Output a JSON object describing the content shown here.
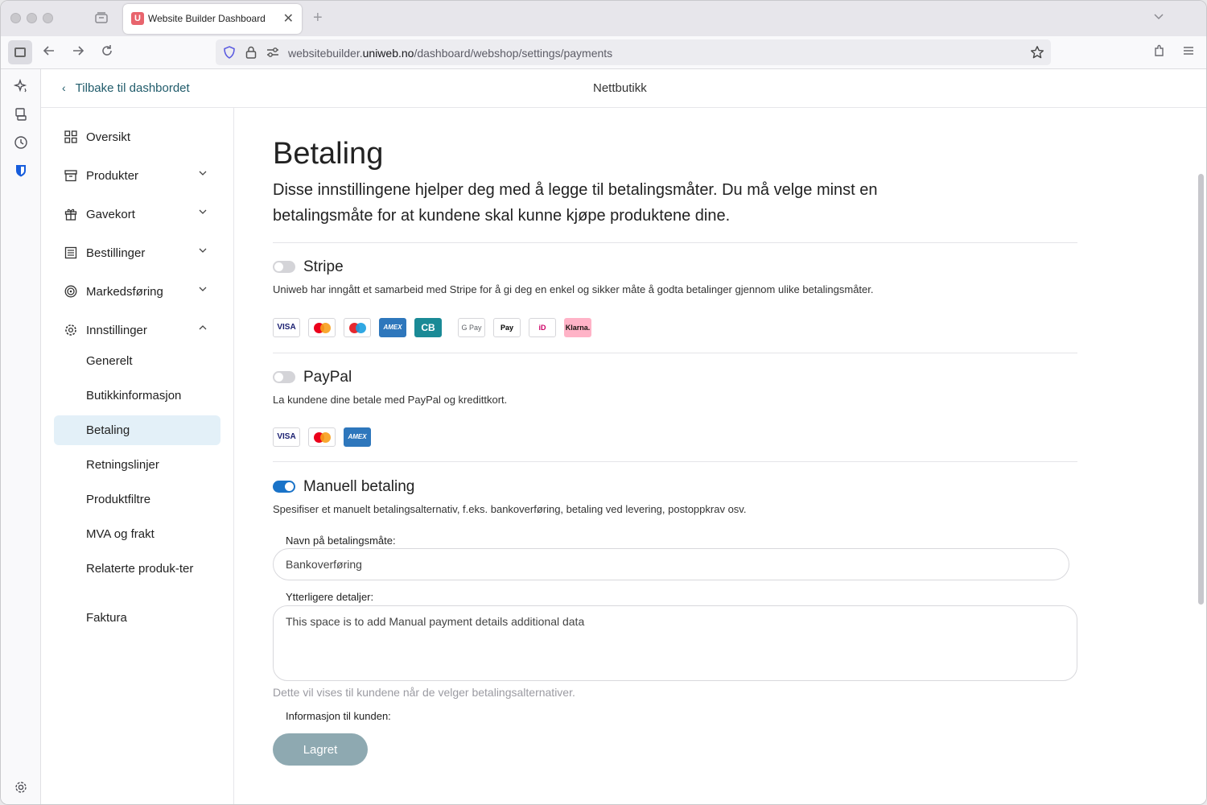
{
  "browser": {
    "tab_title": "Website Builder Dashboard",
    "tab_favicon": "U",
    "url_prefix": "websitebuilder.",
    "url_domain": "uniweb.no",
    "url_path": "/dashboard/webshop/settings/payments"
  },
  "header": {
    "back_label": "Tilbake til dashbordet",
    "title": "Nettbutikk"
  },
  "sidebar": {
    "items": [
      {
        "label": "Oversikt",
        "icon": "grid-icon"
      },
      {
        "label": "Produkter",
        "icon": "archive-icon"
      },
      {
        "label": "Gavekort",
        "icon": "gift-icon"
      },
      {
        "label": "Bestillinger",
        "icon": "list-icon"
      },
      {
        "label": "Markedsføring",
        "icon": "target-icon"
      },
      {
        "label": "Innstillinger",
        "icon": "gear-icon"
      }
    ],
    "sub_items": [
      {
        "label": "Generelt"
      },
      {
        "label": "Butikkinformasjon"
      },
      {
        "label": "Betaling",
        "active": true
      },
      {
        "label": "Retningslinjer"
      },
      {
        "label": "Produktfiltre"
      },
      {
        "label": "MVA og frakt"
      },
      {
        "label": "Relaterte produk-ter"
      },
      {
        "label": "Faktura"
      }
    ]
  },
  "main": {
    "title": "Betaling",
    "description": "Disse innstillingene hjelper deg med å legge til betalingsmåter. Du må velge minst en betalingsmåte for at kundene skal kunne kjøpe produktene dine.",
    "stripe": {
      "title": "Stripe",
      "enabled": false,
      "description": "Uniweb har inngått et samarbeid med Stripe for å gi deg en enkel og sikker måte å godta betalinger gjennom ulike betalingsmåter.",
      "card_labels": {
        "visa": "VISA",
        "amex": "AMEX",
        "cb": "CB",
        "gpay": "G Pay",
        "apay": " Pay",
        "ideal": "iD",
        "klarna": "Klarna."
      }
    },
    "paypal": {
      "title": "PayPal",
      "enabled": false,
      "description": "La kundene dine betale med PayPal og kredittkort.",
      "card_labels": {
        "visa": "VISA",
        "amex": "AMEX"
      }
    },
    "manual": {
      "title": "Manuell betaling",
      "enabled": true,
      "description": "Spesifiser et manuelt betalingsalternativ, f.eks. bankoverføring, betaling ved levering, postoppkrav osv.",
      "name_label": "Navn på betalingsmåte:",
      "name_value": "Bankoverføring",
      "details_label": "Ytterligere detaljer:",
      "details_value": "This space is to add Manual payment details additional data",
      "details_hint": "Dette vil vises til kundene når de velger betalingsalternativer.",
      "info_label": "Informasjon til kunden:",
      "save_label": "Lagret"
    }
  }
}
